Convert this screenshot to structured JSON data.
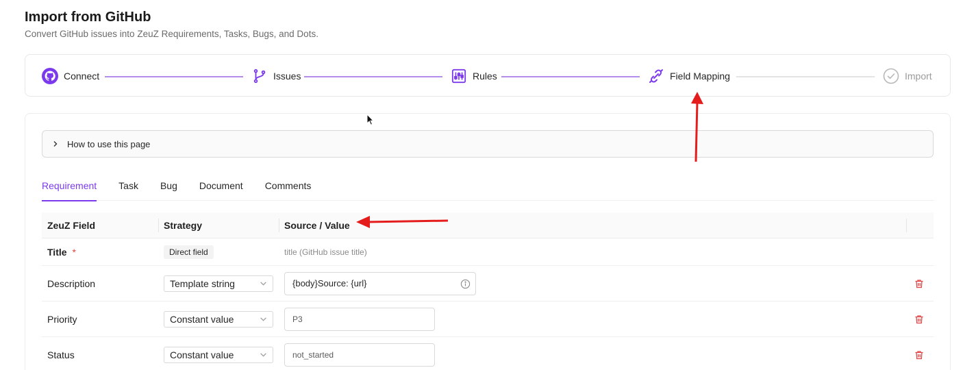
{
  "header": {
    "title": "Import from GitHub",
    "subtitle": "Convert GitHub issues into ZeuZ Requirements, Tasks, Bugs, and Dots."
  },
  "steps": [
    {
      "label": "Connect",
      "icon": "github-icon",
      "state": "done"
    },
    {
      "label": "Issues",
      "icon": "branch-icon",
      "state": "done"
    },
    {
      "label": "Rules",
      "icon": "sliders-icon",
      "state": "done"
    },
    {
      "label": "Field Mapping",
      "icon": "link-icon",
      "state": "current"
    },
    {
      "label": "Import",
      "icon": "check-circle-icon",
      "state": "pending"
    }
  ],
  "howto": {
    "label": "How to use this page"
  },
  "tabs": [
    {
      "label": "Requirement",
      "active": true
    },
    {
      "label": "Task",
      "active": false
    },
    {
      "label": "Bug",
      "active": false
    },
    {
      "label": "Document",
      "active": false
    },
    {
      "label": "Comments",
      "active": false
    }
  ],
  "table": {
    "headers": {
      "field": "ZeuZ Field",
      "strategy": "Strategy",
      "source": "Source / Value"
    },
    "rows": [
      {
        "field": "Title",
        "required": "*",
        "strategy": "Direct field",
        "source": "title (GitHub issue title)"
      },
      {
        "field": "Description",
        "strategy": "Template string",
        "source": "{body}Source: {url}"
      },
      {
        "field": "Priority",
        "strategy": "Constant value",
        "source": "P3"
      },
      {
        "field": "Status",
        "strategy": "Constant value",
        "source": "not_started"
      }
    ]
  },
  "colors": {
    "accent": "#7c3aed",
    "danger": "#e24444",
    "annotation": "#e51c1c"
  }
}
